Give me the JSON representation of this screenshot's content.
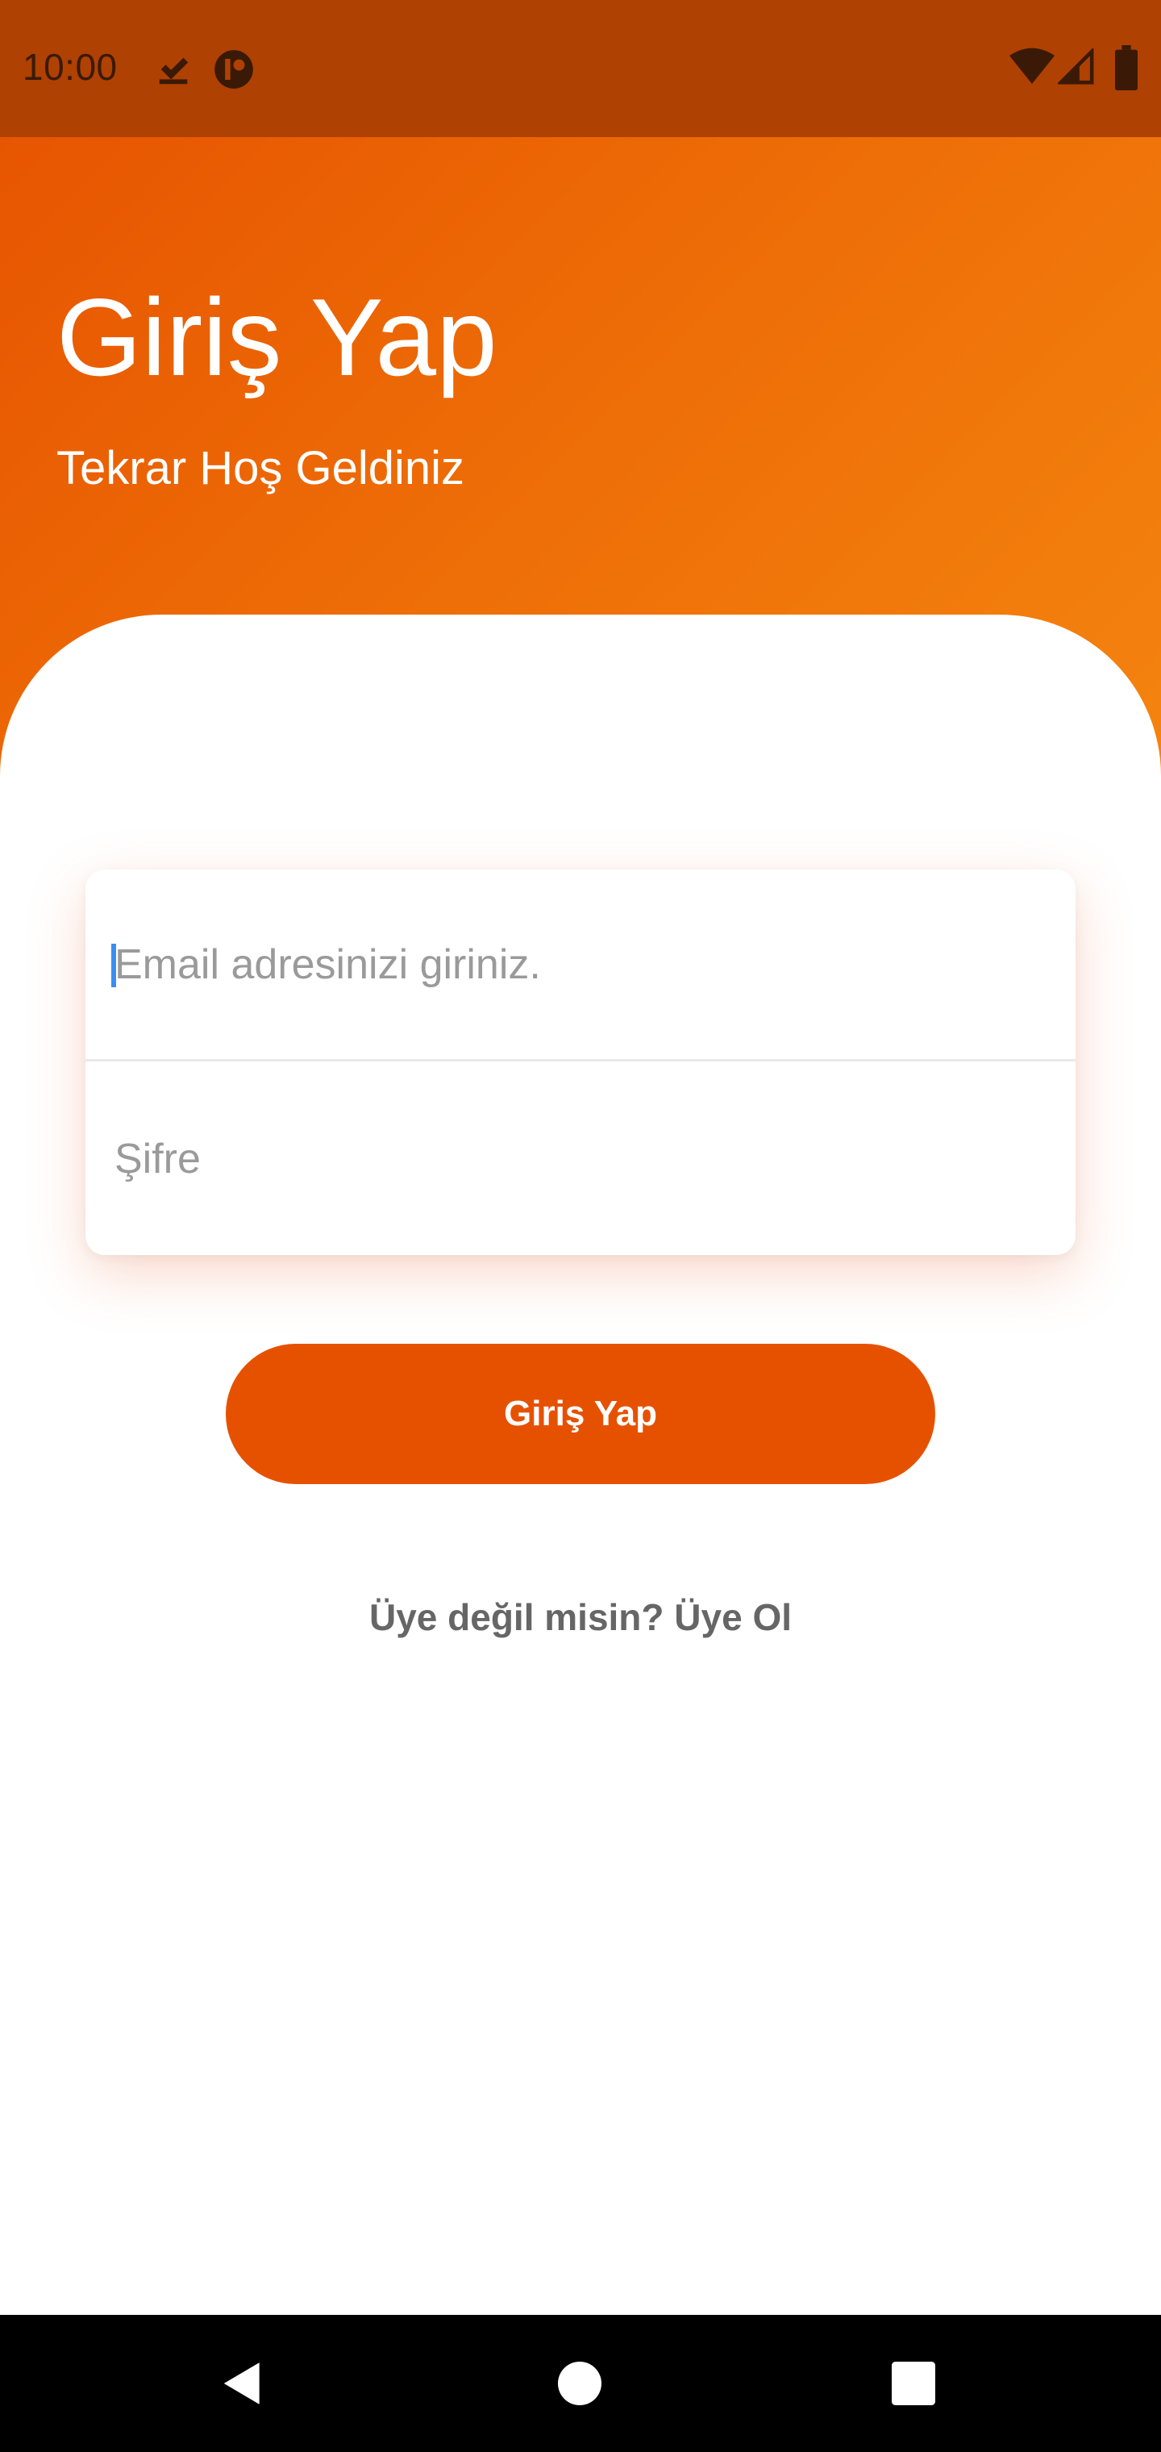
{
  "status_bar": {
    "time": "10:00",
    "left_icons": [
      "download-done-icon",
      "app-notification-icon"
    ],
    "right_icons": [
      "wifi-icon",
      "cellular-signal-icon",
      "battery-icon"
    ]
  },
  "header": {
    "title": "Giriş Yap",
    "subtitle": "Tekrar Hoş Geldiniz"
  },
  "form": {
    "email_value": "",
    "email_placeholder": "Email adresinizi giriniz.",
    "password_value": "",
    "password_placeholder": "Şifre",
    "login_button_label": "Giriş Yap",
    "signup_link_text": "Üye değil misin? Üye Ol"
  },
  "nav_bar": {
    "buttons": [
      "back-icon",
      "home-icon",
      "recents-icon"
    ]
  },
  "colors": {
    "accent": "#e65100",
    "header_gradient_start": "#e65100",
    "header_gradient_end": "#f4840f",
    "status_bar": "#af4102",
    "nav_bar": "#000000",
    "link_text": "#666666"
  }
}
